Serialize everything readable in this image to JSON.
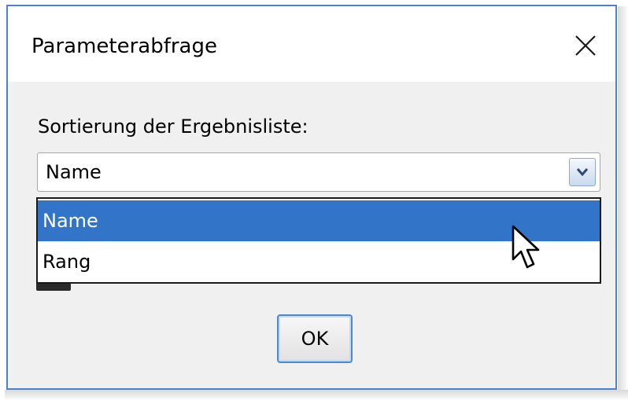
{
  "dialog": {
    "title": "Parameterabfrage",
    "close_icon": "close-icon"
  },
  "form": {
    "label": "Sortierung der Ergebnisliste:",
    "select": {
      "value": "Name",
      "arrow_icon": "chevron-down-icon",
      "expanded": true,
      "options": [
        {
          "label": "Name",
          "highlighted": true
        },
        {
          "label": "Rang",
          "highlighted": false
        }
      ]
    }
  },
  "buttons": {
    "ok_label": "OK"
  },
  "cursor": {
    "icon": "mouse-pointer-icon"
  },
  "colors": {
    "border_accent": "#4a82cf",
    "selection": "#3274c8",
    "background": "#f0f0f0"
  }
}
